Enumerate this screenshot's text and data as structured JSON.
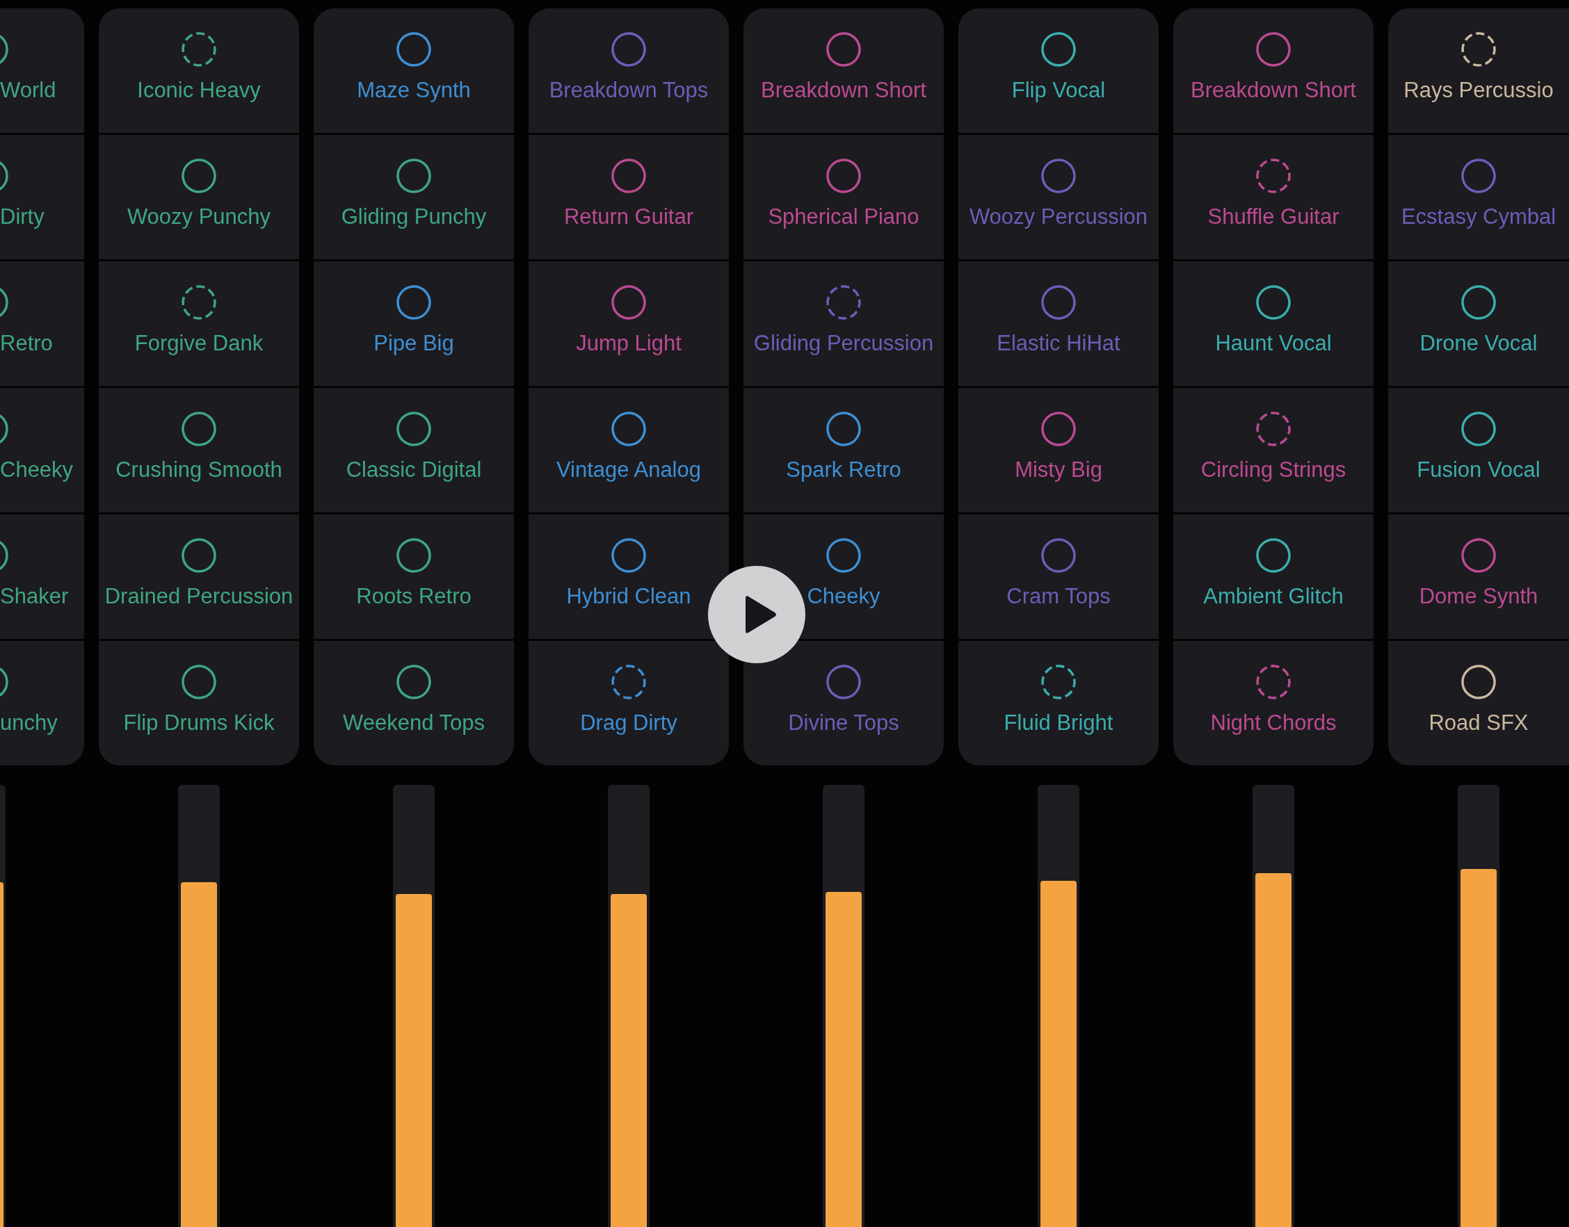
{
  "cut_off_column": {
    "cells": [
      {
        "name": "World",
        "color": "#3ea683"
      },
      {
        "name": "Dirty",
        "color": "#3ea683"
      },
      {
        "name": "Retro",
        "color": "#3ea683"
      },
      {
        "name": "Cheeky",
        "color": "#3ea683"
      },
      {
        "name": "Shaker",
        "color": "#3ea683"
      },
      {
        "name": "unchy",
        "color": "#3ea683"
      }
    ],
    "meter": {
      "level": 0.78
    }
  },
  "columns": [
    {
      "cells": [
        {
          "name": "Iconic Heavy",
          "color": "#3ea683",
          "dashed": true
        },
        {
          "name": "Woozy Punchy",
          "color": "#3ea683",
          "dashed": false
        },
        {
          "name": "Forgive Dank",
          "color": "#3ea683",
          "dashed": true
        },
        {
          "name": "Crushing Smooth",
          "color": "#3ea683",
          "dashed": false
        },
        {
          "name": "Drained Percussion",
          "color": "#3ea683",
          "dashed": false
        },
        {
          "name": "Flip Drums Kick",
          "color": "#3ea683",
          "dashed": false
        }
      ],
      "meter": {
        "level": 0.78
      }
    },
    {
      "cells": [
        {
          "name": "Maze Synth",
          "color": "#3d8fd4",
          "dashed": false
        },
        {
          "name": "Gliding Punchy",
          "color": "#3ea683",
          "dashed": false
        },
        {
          "name": "Pipe Big",
          "color": "#3d8fd4",
          "dashed": false
        },
        {
          "name": "Classic Digital",
          "color": "#3ea683",
          "dashed": false
        },
        {
          "name": "Roots Retro",
          "color": "#3ea683",
          "dashed": false
        },
        {
          "name": "Weekend Tops",
          "color": "#3ea683",
          "dashed": false
        }
      ],
      "meter": {
        "level": 0.753
      }
    },
    {
      "cells": [
        {
          "name": "Breakdown Tops",
          "color": "#6f5cb8",
          "dashed": false
        },
        {
          "name": "Return Guitar",
          "color": "#bb4a92",
          "dashed": false
        },
        {
          "name": "Jump Light",
          "color": "#bb4a92",
          "dashed": false
        },
        {
          "name": "Vintage Analog",
          "color": "#3d8fd4",
          "dashed": false
        },
        {
          "name": "Hybrid Clean",
          "color": "#3d8fd4",
          "dashed": false
        },
        {
          "name": "Drag Dirty",
          "color": "#3d8fd4",
          "dashed": true
        }
      ],
      "meter": {
        "level": 0.753
      }
    },
    {
      "cells": [
        {
          "name": "Breakdown Short",
          "color": "#bb4a92",
          "dashed": false
        },
        {
          "name": "Spherical Piano",
          "color": "#bb4a92",
          "dashed": false
        },
        {
          "name": "Gliding Percussion",
          "color": "#6f5cb8",
          "dashed": true
        },
        {
          "name": "Spark Retro",
          "color": "#3d8fd4",
          "dashed": false
        },
        {
          "name": "Cheeky",
          "color": "#3d8fd4",
          "dashed": false
        },
        {
          "name": "Divine Tops",
          "color": "#6f5cb8",
          "dashed": false
        }
      ],
      "meter": {
        "level": 0.758
      }
    },
    {
      "cells": [
        {
          "name": "Flip Vocal",
          "color": "#3aaeae",
          "dashed": false
        },
        {
          "name": "Woozy Percussion",
          "color": "#6f5cb8",
          "dashed": false
        },
        {
          "name": "Elastic HiHat",
          "color": "#6f5cb8",
          "dashed": false
        },
        {
          "name": "Misty Big",
          "color": "#bb4a92",
          "dashed": false
        },
        {
          "name": "Cram Tops",
          "color": "#6f5cb8",
          "dashed": false
        },
        {
          "name": "Fluid Bright",
          "color": "#3aaeae",
          "dashed": true
        }
      ],
      "meter": {
        "level": 0.783
      }
    },
    {
      "cells": [
        {
          "name": "Breakdown Short",
          "color": "#bb4a92",
          "dashed": false
        },
        {
          "name": "Shuffle Guitar",
          "color": "#bb4a92",
          "dashed": true
        },
        {
          "name": "Haunt Vocal",
          "color": "#3aaeae",
          "dashed": false
        },
        {
          "name": "Circling Strings",
          "color": "#bb4a92",
          "dashed": true
        },
        {
          "name": "Ambient Glitch",
          "color": "#3aaeae",
          "dashed": false
        },
        {
          "name": "Night Chords",
          "color": "#bb4a92",
          "dashed": true
        }
      ],
      "meter": {
        "level": 0.8
      }
    },
    {
      "cells": [
        {
          "name": "Rays Percussio",
          "color": "#cbb89e",
          "dashed": true
        },
        {
          "name": "Ecstasy Cymbal",
          "color": "#6f5cb8",
          "dashed": false
        },
        {
          "name": "Drone Vocal",
          "color": "#3aaeae",
          "dashed": false
        },
        {
          "name": "Fusion Vocal",
          "color": "#3aaeae",
          "dashed": false
        },
        {
          "name": "Dome Synth",
          "color": "#bb4a92",
          "dashed": false
        },
        {
          "name": "Road SFX",
          "color": "#cbb89e",
          "dashed": false
        }
      ],
      "meter": {
        "level": 0.81
      }
    }
  ]
}
